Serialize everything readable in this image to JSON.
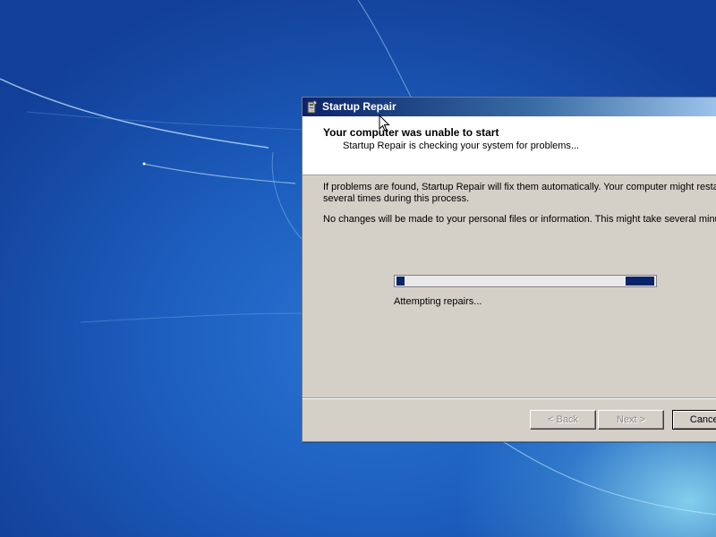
{
  "window": {
    "title": "Startup Repair",
    "header_title": "Your computer was unable to start",
    "header_subtitle": "Startup Repair is checking your system for problems...",
    "paragraph1_line1": "If problems are found, Startup Repair will fix them automatically. Your computer might restart",
    "paragraph1_line2": "several times during this process.",
    "paragraph2": "No changes will be made to your personal files or information. This might take several minutes.",
    "status_text": "Attempting repairs...",
    "buttons": {
      "back": "< Back",
      "next": "Next >",
      "cancel": "Cancel"
    }
  },
  "progress": {
    "style": "marquee",
    "segments": [
      {
        "start": 0.0,
        "end": 0.03
      },
      {
        "start": 0.89,
        "end": 1.0
      }
    ]
  },
  "colors": {
    "titlebar_start": "#0a246a",
    "titlebar_end": "#a6caf0",
    "progress_fill": "#0a246a",
    "desktop": "#1c5bb8"
  },
  "icons": {
    "title_icon": "startup-repair-icon",
    "cursor": "arrow-cursor-icon"
  }
}
